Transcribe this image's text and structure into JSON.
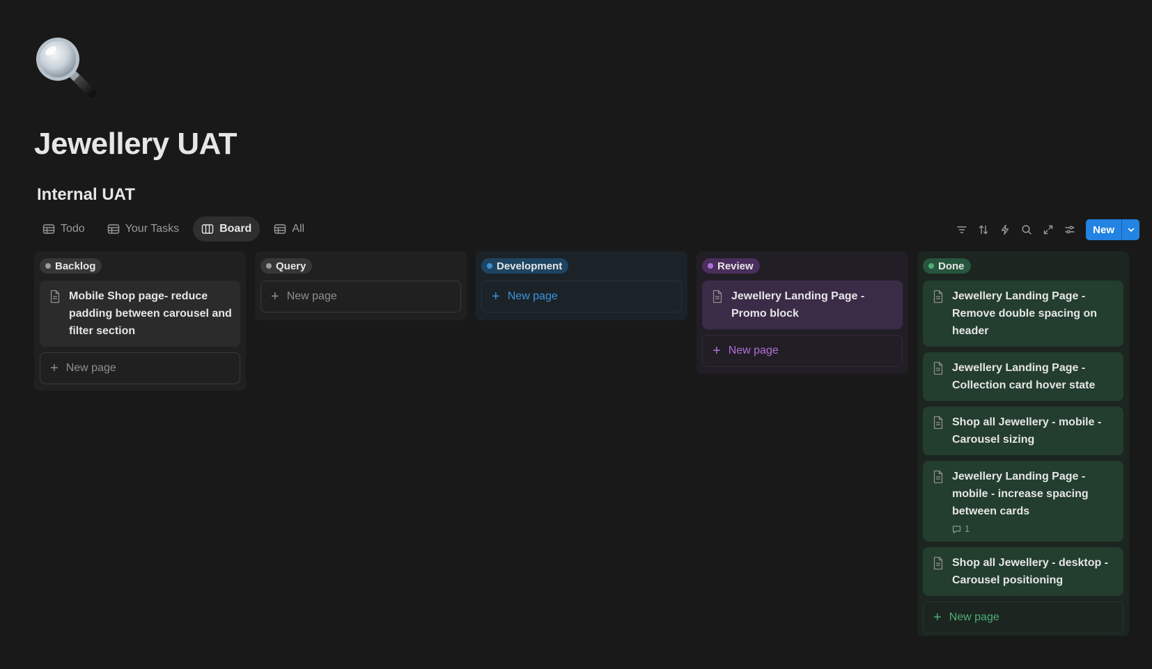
{
  "page": {
    "title": "Jewellery UAT",
    "database_title": "Internal UAT",
    "icon": "magnifying-glass-icon"
  },
  "views": [
    {
      "label": "Todo",
      "icon": "table-icon",
      "active": false
    },
    {
      "label": "Your Tasks",
      "icon": "table-icon",
      "active": false
    },
    {
      "label": "Board",
      "icon": "board-icon",
      "active": true
    },
    {
      "label": "All",
      "icon": "table-icon",
      "active": false
    }
  ],
  "toolbar": {
    "tools": [
      "filter-icon",
      "sort-icon",
      "automation-icon",
      "search-icon",
      "expand-icon",
      "settings-icon"
    ],
    "new_label": "New"
  },
  "board": {
    "new_page_label": "New page",
    "columns": [
      {
        "name": "Backlog",
        "color": "#9b9b9b",
        "cards": [
          {
            "title": "Mobile Shop page- reduce padding between carousel and filter section"
          }
        ]
      },
      {
        "name": "Query",
        "color": "#9b9b9b",
        "cards": []
      },
      {
        "name": "Development",
        "color": "#3c8fd4",
        "cards": []
      },
      {
        "name": "Review",
        "color": "#b06fd8",
        "cards": [
          {
            "title": "Jewellery Landing Page - Promo block"
          }
        ]
      },
      {
        "name": "Done",
        "color": "#4caf76",
        "cards": [
          {
            "title": "Jewellery Landing Page - Remove double spacing on header"
          },
          {
            "title": "Jewellery Landing Page - Collection card hover state"
          },
          {
            "title": "Shop all Jewellery - mobile - Carousel sizing"
          },
          {
            "title": "Jewellery Landing Page - mobile - increase spacing between cards",
            "comments": "1"
          },
          {
            "title": "Shop all Jewellery - desktop - Carousel positioning"
          }
        ]
      }
    ]
  }
}
